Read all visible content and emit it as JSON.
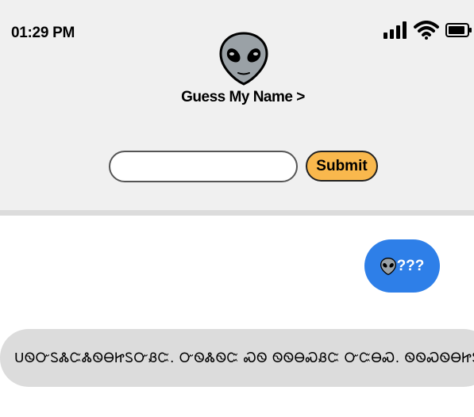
{
  "status_bar": {
    "time": "01:29 PM",
    "icons": [
      "signal-icon",
      "wifi-icon",
      "battery-icon"
    ]
  },
  "header": {
    "avatar_icon": "alien-icon",
    "title": "Guess My Name >"
  },
  "form": {
    "input_value": "",
    "input_placeholder": "",
    "submit_label": "Submit"
  },
  "chat": {
    "user_message": {
      "icon": "alien-icon",
      "text": "???"
    },
    "bot_message": {
      "text": "ᑌᏫᏅᏚᏜᏨᏜᏫᎾᏥᏚᏅᏰᏨ. ᏅᏫᏜᏫᏨ ᏍᏫ ᏫᏫᎾᏍᏰᏨ ᏅᏨᎾᏍ. ᏫᏫᏍᏫᎾᏥᏚᏰᏍ",
      "icon": "pile-of-poo-icon"
    }
  },
  "colors": {
    "header_bg": "#f0f0f0",
    "divider": "#dcdcdc",
    "submit_bg": "#f9b84d",
    "user_bubble": "#2e7fe8",
    "bot_bubble": "#dcdcdc"
  }
}
